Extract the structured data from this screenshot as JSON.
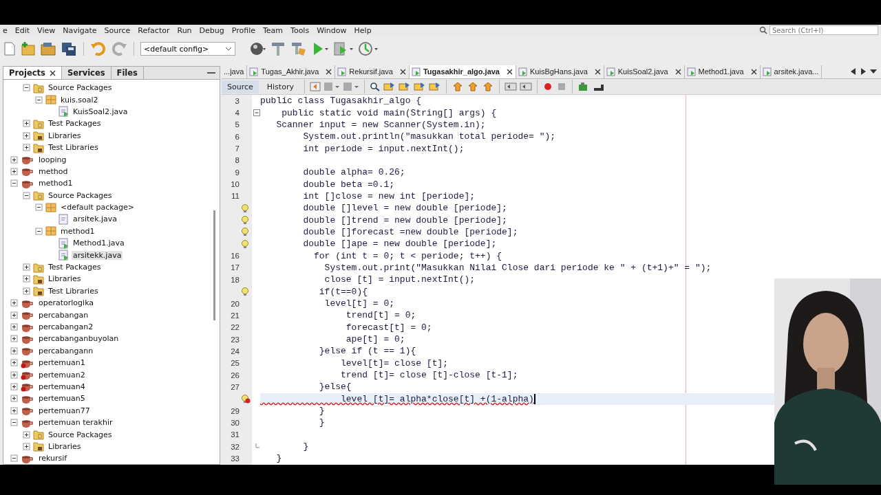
{
  "menu": [
    "e",
    "Edit",
    "View",
    "Navigate",
    "Source",
    "Refactor",
    "Run",
    "Debug",
    "Profile",
    "Team",
    "Tools",
    "Window",
    "Help"
  ],
  "search": {
    "placeholder": "Search (Ctrl+I)"
  },
  "toolbar": {
    "config": "<default config>"
  },
  "panel_tabs": [
    {
      "label": "Projects",
      "selected": true
    },
    {
      "label": "Services",
      "selected": false
    },
    {
      "label": "Files",
      "selected": false
    }
  ],
  "tree_continued": [
    {
      "label": "Source Packages",
      "kind": "source",
      "expanded": true,
      "selected": false,
      "children": [
        {
          "label": "kuis.soal2",
          "kind": "package",
          "expanded": true,
          "selected": false,
          "children": [
            {
              "label": "KuisSoal2.java",
              "kind": "file",
              "selected": false
            }
          ]
        }
      ]
    },
    {
      "label": "Test Packages",
      "kind": "source",
      "expanded": false,
      "selected": false
    },
    {
      "label": "Libraries",
      "kind": "library",
      "expanded": false,
      "selected": false
    },
    {
      "label": "Test Libraries",
      "kind": "library",
      "expanded": false,
      "selected": false
    }
  ],
  "projects": [
    {
      "label": "looping",
      "kind": "project",
      "expanded": false,
      "selected": false
    },
    {
      "label": "method",
      "kind": "project",
      "expanded": false,
      "selected": false
    },
    {
      "label": "method1",
      "kind": "project",
      "expanded": true,
      "selected": false,
      "children": [
        {
          "label": "Source Packages",
          "kind": "source",
          "expanded": true,
          "selected": false,
          "children": [
            {
              "label": "<default package>",
              "kind": "package",
              "expanded": true,
              "selected": false,
              "children": [
                {
                  "label": "arsitek.java",
                  "kind": "file-plain",
                  "selected": false
                }
              ]
            },
            {
              "label": "method1",
              "kind": "package",
              "expanded": true,
              "selected": false,
              "children": [
                {
                  "label": "Method1.java",
                  "kind": "file",
                  "selected": false
                },
                {
                  "label": "arsitekk.java",
                  "kind": "file",
                  "selected": true
                }
              ]
            }
          ]
        },
        {
          "label": "Test Packages",
          "kind": "source",
          "expanded": false,
          "selected": false
        },
        {
          "label": "Libraries",
          "kind": "library",
          "expanded": false,
          "selected": false
        },
        {
          "label": "Test Libraries",
          "kind": "library",
          "expanded": false,
          "selected": false
        }
      ]
    },
    {
      "label": "operatorlogika",
      "kind": "project",
      "expanded": false,
      "selected": false
    },
    {
      "label": "percabangan",
      "kind": "project",
      "expanded": false,
      "selected": false
    },
    {
      "label": "percabangan2",
      "kind": "project",
      "expanded": false,
      "selected": false
    },
    {
      "label": "percabanganbuyolan",
      "kind": "project",
      "expanded": false,
      "selected": false
    },
    {
      "label": "percabangann",
      "kind": "project",
      "expanded": false,
      "selected": false
    },
    {
      "label": "pertemuan1",
      "kind": "project-error",
      "expanded": false,
      "selected": false
    },
    {
      "label": "pertemuan2",
      "kind": "project-error",
      "expanded": false,
      "selected": false
    },
    {
      "label": "pertemuan4",
      "kind": "project-error",
      "expanded": false,
      "selected": false
    },
    {
      "label": "pertemuan5",
      "kind": "project",
      "expanded": false,
      "selected": false
    },
    {
      "label": "pertemuan77",
      "kind": "project",
      "expanded": false,
      "selected": false
    },
    {
      "label": "pertemuan terakhir",
      "kind": "project",
      "expanded": true,
      "selected": false,
      "children": [
        {
          "label": "Source Packages",
          "kind": "source",
          "expanded": false,
          "selected": false
        },
        {
          "label": "Libraries",
          "kind": "library",
          "expanded": false,
          "selected": false
        }
      ]
    },
    {
      "label": "rekursif",
      "kind": "project",
      "expanded": true,
      "selected": false
    }
  ],
  "editor_tabs": [
    {
      "label": "...java",
      "selected": false,
      "closable": false
    },
    {
      "label": "Tugas_Akhir.java",
      "selected": false,
      "closable": true
    },
    {
      "label": "Rekursif.java",
      "selected": false,
      "closable": true
    },
    {
      "label": "Tugasakhir_algo.java",
      "selected": true,
      "closable": true
    },
    {
      "label": "KuisBgHans.java",
      "selected": false,
      "closable": true
    },
    {
      "label": "KuisSoal2.java",
      "selected": false,
      "closable": true
    },
    {
      "label": "Method1.java",
      "selected": false,
      "closable": true
    },
    {
      "label": "arsitek.java...",
      "selected": false,
      "closable": false
    }
  ],
  "view_tabs": [
    {
      "label": "Source",
      "selected": true
    },
    {
      "label": "History",
      "selected": false
    }
  ],
  "code": [
    {
      "n": "3",
      "text": "public class Tugasakhir_algo {",
      "kind": "plain",
      "current": false
    },
    {
      "n": "4",
      "text": "    public static void main(String[] args) {",
      "kind": "fold-start",
      "current": false
    },
    {
      "n": "5",
      "text": "   Scanner input = new Scanner(System.in);",
      "kind": "plain",
      "current": false
    },
    {
      "n": "6",
      "text": "        System.out.println(\"masukkan total periode= \");",
      "kind": "plain",
      "current": false
    },
    {
      "n": "7",
      "text": "        int periode = input.nextInt();",
      "kind": "plain",
      "current": false
    },
    {
      "n": "8",
      "kind": "plain",
      "current": false
    },
    {
      "n": "9",
      "text": "        double alpha= 0.26;",
      "kind": "plain",
      "current": false
    },
    {
      "n": "10",
      "text": "        double beta =0.1;",
      "kind": "plain",
      "current": false
    },
    {
      "n": "11",
      "text": "        int []close = new int [periode];",
      "kind": "plain",
      "current": false
    },
    {
      "text": "        double []level = new double [periode];",
      "kind": "hint",
      "current": false
    },
    {
      "text": "        double []trend = new double [periode];",
      "kind": "hint",
      "current": false
    },
    {
      "text": "        double []forecast =new double [periode];",
      "kind": "hint",
      "current": false
    },
    {
      "text": "        double []ape = new double [periode];",
      "kind": "hint",
      "current": false
    },
    {
      "n": "16",
      "text": "          for (int t = 0; t < periode; t++) {",
      "kind": "plain",
      "current": false
    },
    {
      "n": "17",
      "text": "            System.out.print(\"Masukkan Nilai Close dari periode ke \" + (t+1)+\" = \");",
      "kind": "plain",
      "current": false
    },
    {
      "n": "18",
      "text": "            close [t] = input.nextInt();",
      "kind": "plain",
      "current": false
    },
    {
      "text": "           if(t==0){",
      "kind": "hint",
      "current": false
    },
    {
      "n": "20",
      "text": "            level[t] = 0;",
      "kind": "plain",
      "current": false
    },
    {
      "n": "21",
      "text": "                trend[t] = 0;",
      "kind": "plain",
      "current": false
    },
    {
      "n": "22",
      "text": "                forecast[t] = 0;",
      "kind": "plain",
      "current": false
    },
    {
      "n": "23",
      "text": "                ape[t] = 0;",
      "kind": "plain",
      "current": false
    },
    {
      "n": "24",
      "text": "           }else if (t == 1){",
      "kind": "plain",
      "current": false
    },
    {
      "n": "25",
      "text": "               level[t]= close [t];",
      "kind": "plain",
      "current": false
    },
    {
      "n": "26",
      "text": "               trend [t]= close [t]-close [t-1];",
      "kind": "plain",
      "current": false
    },
    {
      "n": "27",
      "text": "           }else{",
      "kind": "plain",
      "current": false
    },
    {
      "text": "               level [t]= alpha*close[t] +(1-alpha)",
      "kind": "error",
      "current": true
    },
    {
      "n": "29",
      "text": "           }",
      "kind": "plain",
      "current": false
    },
    {
      "n": "30",
      "text": "           }",
      "kind": "plain",
      "current": false
    },
    {
      "n": "31",
      "kind": "plain",
      "current": false
    },
    {
      "n": "32",
      "text": "        }",
      "kind": "fold-end",
      "current": false
    },
    {
      "n": "33",
      "text": "   }",
      "kind": "plain",
      "current": false
    }
  ]
}
